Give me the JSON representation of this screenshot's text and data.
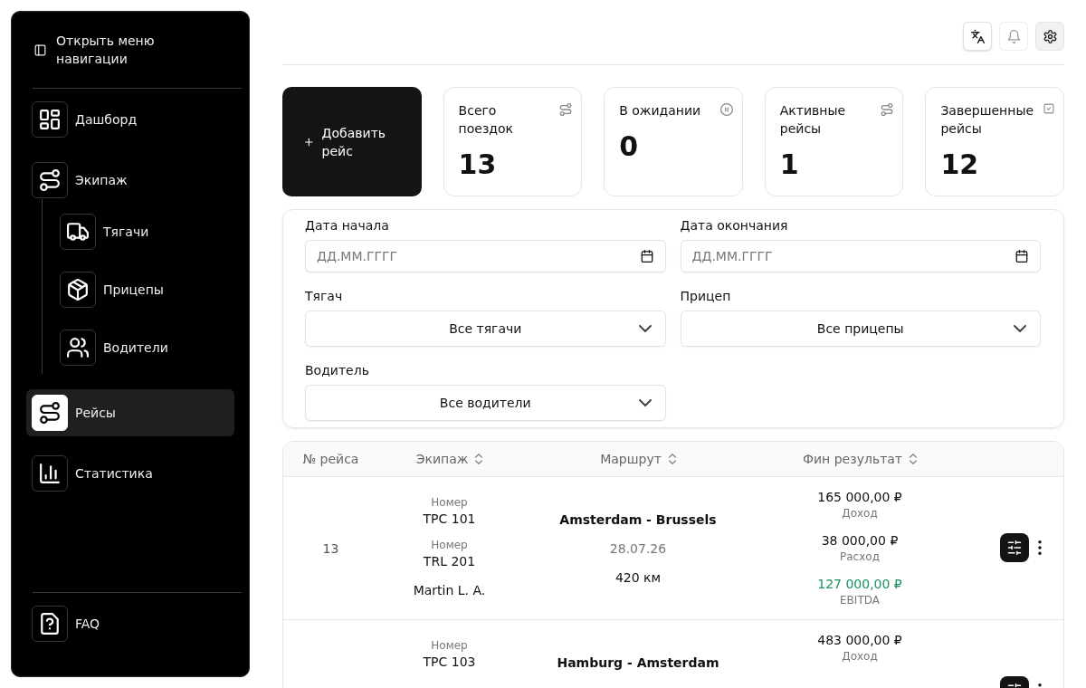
{
  "sidebar": {
    "toggle": {
      "label": "Открыть меню навигации"
    },
    "items": [
      {
        "label": "Дашборд",
        "selected": false
      },
      {
        "label": "Экипаж",
        "selected": false,
        "expanded": true,
        "children": [
          {
            "label": "Тягачи",
            "selected": false
          },
          {
            "label": "Прицепы",
            "selected": false
          },
          {
            "label": "Водители",
            "selected": false
          }
        ]
      },
      {
        "label": "Рейсы",
        "selected": true
      },
      {
        "label": "Статистика",
        "selected": false
      }
    ],
    "footer_items": [
      {
        "label": "FAQ",
        "selected": false
      }
    ]
  },
  "toolbar": {
    "buttons": [
      {
        "kind": "outline"
      },
      {
        "kind": "ghost"
      },
      {
        "kind": "secondary"
      }
    ]
  },
  "add_trip_button": {
    "label": "Добавить рейс"
  },
  "stats": [
    {
      "label": "Всего поездок",
      "value": "13"
    },
    {
      "label": "В ожидании",
      "value": "0"
    },
    {
      "label": "Активные рейсы",
      "value": "1"
    },
    {
      "label": "Завершенные рейсы",
      "value": "12"
    }
  ],
  "filters": [
    {
      "kind": "date",
      "label": "Дата начала",
      "placeholder": "ДД.ММ.ГГГГ"
    },
    {
      "kind": "date",
      "label": "Дата окончания",
      "placeholder": "ДД.ММ.ГГГГ"
    },
    {
      "kind": "select",
      "label": "Тягач",
      "value": "Все тягачи"
    },
    {
      "kind": "select",
      "label": "Прицеп",
      "value": "Все прицепы"
    },
    {
      "kind": "select",
      "label": "Водитель",
      "value": "Все водители"
    }
  ],
  "table": {
    "columns": [
      {
        "label": "№ рейса",
        "sortable": false
      },
      {
        "label": "Экипаж",
        "sortable": true
      },
      {
        "label": "Маршрут",
        "sortable": true
      },
      {
        "label": "Фин результат",
        "sortable": true
      }
    ],
    "rows": [
      {
        "number": "13",
        "crew": [
          {
            "caption": "Номер",
            "value": "TPC 101"
          },
          {
            "caption": "Номер",
            "value": "TRL 201"
          }
        ],
        "driver": "Martin L. A.",
        "route": "Amsterdam - Brussels",
        "date": "28.07.26",
        "distance": "420 км",
        "finance": [
          {
            "amount": "165 000,00 ₽",
            "caption": "Доход",
            "kind": "plain"
          },
          {
            "amount": "38 000,00 ₽",
            "caption": "Расход",
            "kind": "plain"
          },
          {
            "amount": "127 000,00 ₽",
            "caption": "EBITDA",
            "kind": "positive"
          }
        ]
      },
      {
        "crew": [
          {
            "caption": "Номер",
            "value": "TPC 103"
          }
        ],
        "route": "Hamburg - Amsterdam",
        "finance": [
          {
            "amount": "483 000,00 ₽",
            "caption": "Доход",
            "kind": "plain"
          }
        ]
      }
    ]
  }
}
